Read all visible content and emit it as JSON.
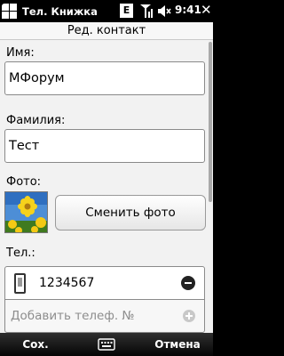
{
  "statusbar": {
    "app_title": "Тел. Книжка",
    "network_badge": "E",
    "time": "9:41",
    "icons": [
      "windows-start-icon",
      "signal-icon",
      "volume-icon",
      "close-icon"
    ]
  },
  "form": {
    "header": "Ред. контакт",
    "first_name_label": "Имя:",
    "first_name_value": "МФорум",
    "last_name_label": "Фамилия:",
    "last_name_value": "Тест",
    "photo_label": "Фото:",
    "change_photo_button": "Сменить фото",
    "phone_label": "Тел.:",
    "phones": [
      {
        "value": "1234567",
        "icon": "mobile-phone-icon"
      }
    ],
    "add_phone_placeholder": "Добавить телеф. №"
  },
  "softkeys": {
    "left": "Сох.",
    "right": "Отмена",
    "center_icon": "keyboard-icon"
  }
}
